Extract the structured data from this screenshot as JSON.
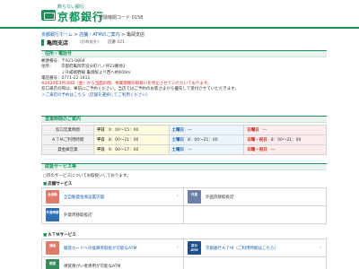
{
  "header": {
    "tagline": "飾らない銀行",
    "bank_name": "京都銀行",
    "bank_code": "金融機関コード 0158"
  },
  "breadcrumb": {
    "home": "京都銀行ホーム",
    "sep1": " > ",
    "stores": "店舗・ATMのご案内",
    "sep2": " > ",
    "current": "亀岡支店"
  },
  "title": {
    "name": "亀岡支店",
    "reading": "（かめおか）",
    "code": "店番 021"
  },
  "sections": {
    "address": "住所・電話号",
    "hours": "営業時間のご案内",
    "services": "取扱サービス等"
  },
  "address": {
    "postal": "郵便番号：〒621-0804",
    "addr_label": "住所：",
    "addr_line1": "京都府亀岡市追分町八ノ坪23番地1",
    "addr_line2": "ＪＲ嵯峨野線 亀岡駅より西へ約600m",
    "phone": "電話番号：0771-22-3411",
    "notice1": "※2020年4月30日（金）から当面の間、休業期間の取扱いを停止させていただいております。",
    "notice2": "窓口来店の際は、事前にご予約ください。当店ではご予約のお客さまから優先して受付させていただきます。",
    "reserve_link": "＞ご来店の予約はこちら（店舗を選択してご利用ください）"
  },
  "hours": {
    "rows": [
      {
        "label": "窓口営業時間",
        "weekday_label": "平日",
        "weekday": "9：00～15：00",
        "sat_label": "土曜日",
        "sat": "―",
        "sun_label": "日曜日",
        "sun": "―"
      },
      {
        "label": "ＡＴＭご利用時間",
        "weekday_label": "平日",
        "weekday": "8：00～21：00",
        "sat_label": "土曜日",
        "sat": "8：00～21：00",
        "sun_label": "日曜・祝日",
        "sun": "8：00～21：00"
      },
      {
        "label": "貸金庫営業",
        "weekday_label": "平日",
        "weekday": "9：00～17：00",
        "sat_label": "土曜日",
        "sat": "―",
        "sun_label": "日曜・祝日",
        "sun": "―"
      }
    ]
  },
  "services": {
    "intro": "○印のサービスについてお取扱いしております。",
    "store_category": "店舗サービス",
    "atm_category": "ＡＴＭサービス",
    "store_items": [
      {
        "icon": "全自動",
        "label": "全自動貸金庫設置店舗"
      },
      {
        "icon": "外貨",
        "label": "外国為替取扱店"
      },
      {
        "icon": "外貨両替",
        "label": "外貨両替取扱店"
      }
    ],
    "atm_items": [
      {
        "icon": "通帳",
        "label": "聴覚カードへの換算券取扱が可能なATM"
      },
      {
        "icon": "京のATM",
        "label": "京都銀行ＡＴＭ（ご利用時間はこちら）"
      },
      {
        "icon": "視覚",
        "label": "視覚障がい者専用が可能なATM"
      }
    ]
  },
  "colors": {
    "brand_green": "#19915a",
    "link_blue": "#1a5fb4",
    "alert_red": "#d9261c"
  }
}
